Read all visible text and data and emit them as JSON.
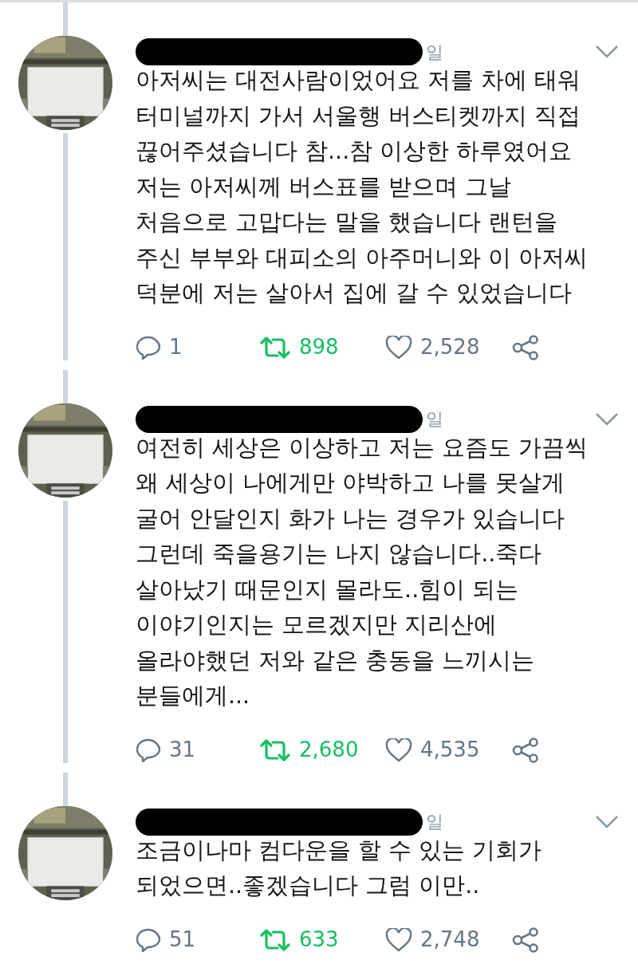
{
  "tweets": [
    {
      "date": "일",
      "lines": [
        "아저씨는 대전사람이었어요 저를 차에 태워",
        "터미널까지 가서 서울행 버스티켓까지 직접",
        "끊어주셨습니다 참...참 이상한 하루였어요",
        "저는 아저씨께 버스표를 받으며 그날",
        "처음으로 고맙다는 말을 했습니다 랜턴을",
        "주신 부부와 대피소의 아주머니와 이 아저씨",
        "덕분에 저는 살아서 집에 갈 수 있었습니다"
      ],
      "replies": "1",
      "retweets": "898",
      "likes": "2,528",
      "retweeted": true,
      "liked": false
    },
    {
      "date": "일",
      "lines": [
        "여전히 세상은 이상하고 저는 요즘도 가끔씩",
        "왜 세상이 나에게만 야박하고 나를 못살게",
        "굴어 안달인지 화가 나는 경우가 있습니다",
        "그런데 죽을용기는 나지 않습니다..죽다",
        "살아났기 때문인지 몰라도..힘이 되는",
        "이야기인지는 모르겠지만 지리산에",
        "올라야했던 저와 같은 충동을 느끼시는",
        "분들에게..."
      ],
      "replies": "31",
      "retweets": "2,680",
      "likes": "4,535",
      "retweeted": true,
      "liked": false
    },
    {
      "date": "일",
      "lines": [
        "조금이나마 컴다운을 할 수 있는 기회가",
        "되었으면..좋겠습니다 그럼 이만.."
      ],
      "replies": "51",
      "retweets": "633",
      "likes": "2,748",
      "retweeted": true,
      "liked": false
    }
  ]
}
